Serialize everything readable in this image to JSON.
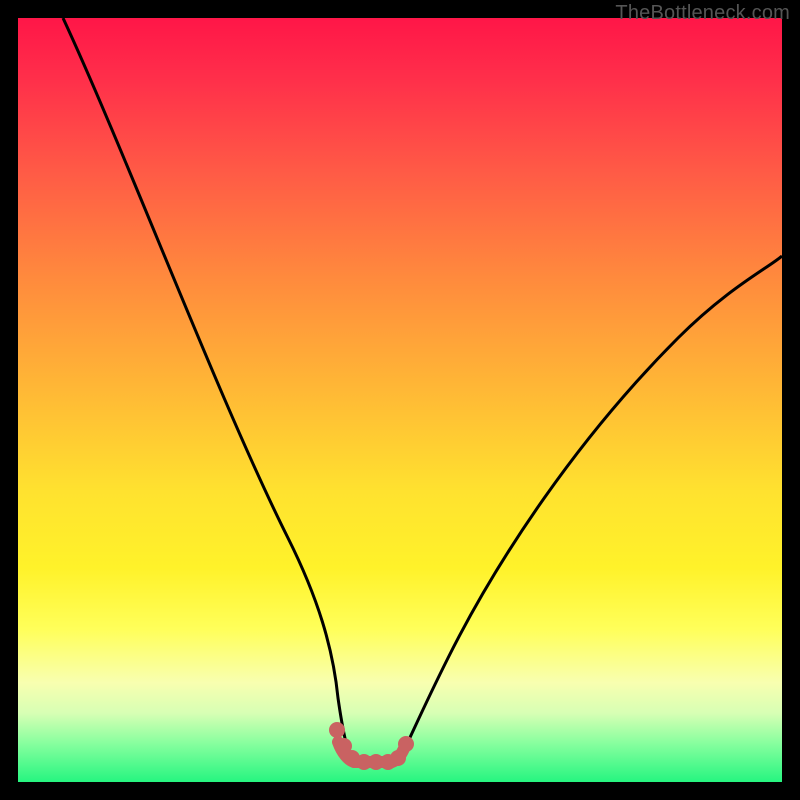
{
  "watermark": {
    "text": "TheBottleneck.com"
  },
  "colors": {
    "frame": "#000000",
    "curve": "#000000",
    "dots": "#c96262",
    "gradient_stops": [
      "#ff1648",
      "#ff2f4a",
      "#ff5a46",
      "#ff8a3d",
      "#ffb636",
      "#ffe22f",
      "#fff22a",
      "#ffff5a",
      "#f8ffb0",
      "#d7ffb4",
      "#86ff9e",
      "#26f580"
    ]
  },
  "chart_data": {
    "type": "line",
    "title": "",
    "xlabel": "",
    "ylabel": "",
    "xlim": [
      0,
      100
    ],
    "ylim": [
      0,
      100
    ],
    "grid": false,
    "legend": false,
    "annotations": [],
    "series": [
      {
        "name": "curve-left-branch",
        "x": [
          6,
          10,
          16,
          22,
          28,
          32,
          36,
          38,
          40,
          41.5,
          42.5,
          43.5
        ],
        "y": [
          100,
          88,
          72,
          56,
          40,
          30,
          20,
          14,
          8,
          5,
          3.4,
          2.8
        ]
      },
      {
        "name": "curve-right-branch",
        "x": [
          49,
          50,
          52,
          56,
          62,
          70,
          80,
          90,
          100
        ],
        "y": [
          2.8,
          3.2,
          6,
          14,
          26,
          40,
          53,
          62,
          69
        ]
      },
      {
        "name": "flat-valley-dots",
        "x": [
          42,
          43.5,
          44.5,
          45.5,
          46.5,
          47.5,
          48.5,
          49.5
        ],
        "y": [
          4.5,
          3.2,
          2.8,
          2.8,
          2.8,
          2.8,
          3.0,
          3.6
        ]
      }
    ]
  }
}
